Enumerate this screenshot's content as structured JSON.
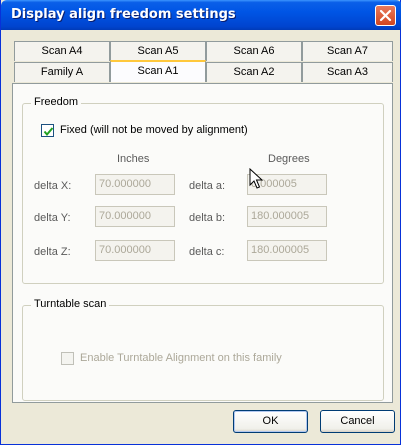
{
  "window": {
    "title": "Display align freedom settings"
  },
  "tabs": {
    "row1": [
      "Scan A4",
      "Scan A5",
      "Scan A6",
      "Scan A7"
    ],
    "row2": [
      "Family A",
      "Scan A1",
      "Scan A2",
      "Scan A3"
    ],
    "active": "Scan A1"
  },
  "freedom": {
    "group_title": "Freedom",
    "fixed_label": "Fixed (will not be moved by alignment)",
    "fixed_checked": true,
    "inches_header": "Inches",
    "degrees_header": "Degrees",
    "delta_x_label": "delta X:",
    "delta_y_label": "delta Y:",
    "delta_z_label": "delta Z:",
    "delta_a_label": "delta a:",
    "delta_b_label": "delta b:",
    "delta_c_label": "delta c:",
    "delta_x": "70.000000",
    "delta_y": "70.000000",
    "delta_z": "70.000000",
    "delta_a": "0.000005",
    "delta_b": "180.000005",
    "delta_c": "180.000005"
  },
  "turntable": {
    "group_title": "Turntable scan",
    "enable_label": "Enable Turntable Alignment on this family",
    "enable_checked": false
  },
  "buttons": {
    "ok": "OK",
    "cancel": "Cancel"
  },
  "colors": {
    "titlebar": "#0055e5",
    "active_tab_accent": "#ffc83c"
  }
}
